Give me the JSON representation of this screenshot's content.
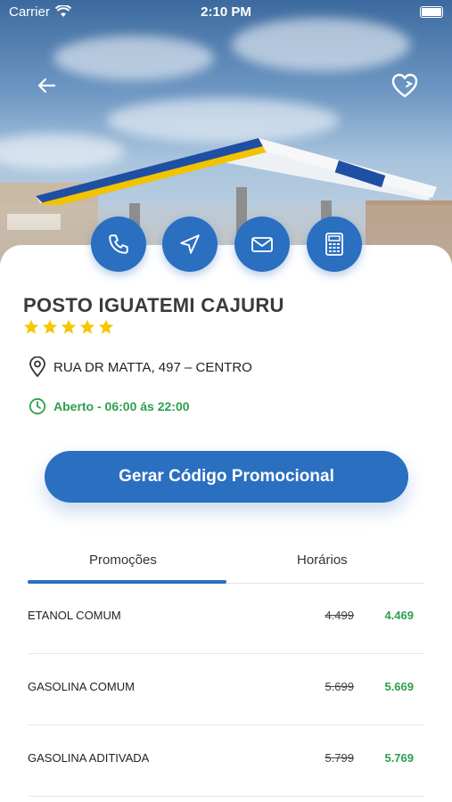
{
  "status_bar": {
    "carrier": "Carrier",
    "time": "2:10 PM"
  },
  "station": {
    "name": "POSTO IGUATEMI CAJURU",
    "rating": 5,
    "address": "RUA DR MATTA, 497 – CENTRO",
    "hours": "Aberto - 06:00 ás 22:00"
  },
  "cta": {
    "label": "Gerar Código Promocional"
  },
  "tabs": [
    {
      "label": "Promoções"
    },
    {
      "label": "Horários"
    }
  ],
  "prices": [
    {
      "name": "ETANOL COMUM",
      "old": "4.499",
      "new": "4.469"
    },
    {
      "name": "GASOLINA COMUM",
      "old": "5.699",
      "new": "5.669"
    },
    {
      "name": "GASOLINA ADITIVADA",
      "old": "5.799",
      "new": "5.769"
    }
  ],
  "colors": {
    "primary": "#2a6fc0",
    "green": "#2e9f4e",
    "star": "#f7c600"
  },
  "icons": [
    "back-arrow-icon",
    "heart-icon",
    "phone-icon",
    "navigation-icon",
    "mail-icon",
    "calculator-icon",
    "location-pin-icon",
    "clock-icon",
    "star-icon"
  ]
}
